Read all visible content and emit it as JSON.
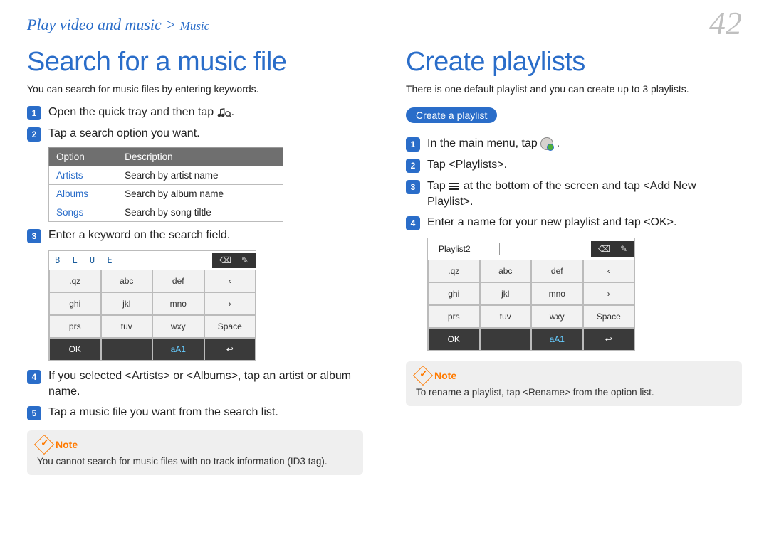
{
  "page_number": "42",
  "breadcrumb": {
    "main": "Play video and music",
    "sep": " > ",
    "sub": "Music"
  },
  "left": {
    "title": "Search for a music file",
    "intro": "You can search for music files by entering keywords.",
    "steps": {
      "s1": "Open the quick tray and then tap ",
      "s2": "Tap a search option you want.",
      "s3": "Enter a keyword on the search field.",
      "s4": "If you selected <Artists> or <Albums>, tap an artist or album name.",
      "s5": "Tap a music file you want from the search list."
    },
    "table": {
      "h1": "Option",
      "h2": "Description",
      "rows": [
        {
          "opt": "Artists",
          "desc": "Search by artist name"
        },
        {
          "opt": "Albums",
          "desc": "Search by album name"
        },
        {
          "opt": "Songs",
          "desc": "Search by song tiltle"
        }
      ]
    },
    "note": {
      "label": "Note",
      "text": "You cannot search for music files with no track information (ID3 tag)."
    },
    "keyboard": {
      "typed": "B L U E",
      "rows": [
        [
          ".qz",
          "abc",
          "def",
          "‹"
        ],
        [
          "ghi",
          "jkl",
          "mno",
          "›"
        ],
        [
          "prs",
          "tuv",
          "wxy",
          "Space"
        ],
        [
          "OK",
          "",
          "aA1",
          "↩"
        ]
      ]
    }
  },
  "right": {
    "title": "Create playlists",
    "intro": "There is one default playlist and you can create up to 3 playlists.",
    "pill": "Create a playlist",
    "steps": {
      "s1": "In the main menu, tap ",
      "s2": "Tap <Playlists>.",
      "s3a": "Tap ",
      "s3b": " at the bottom of the screen and tap <Add New Playlist>.",
      "s4": "Enter a name for your new playlist and tap <OK>."
    },
    "note": {
      "label": "Note",
      "text": "To rename a playlist, tap <Rename> from the option list."
    },
    "keyboard": {
      "typed": "Playlist2",
      "rows": [
        [
          ".qz",
          "abc",
          "def",
          "‹"
        ],
        [
          "ghi",
          "jkl",
          "mno",
          "›"
        ],
        [
          "prs",
          "tuv",
          "wxy",
          "Space"
        ],
        [
          "OK",
          "",
          "aA1",
          "↩"
        ]
      ]
    }
  }
}
